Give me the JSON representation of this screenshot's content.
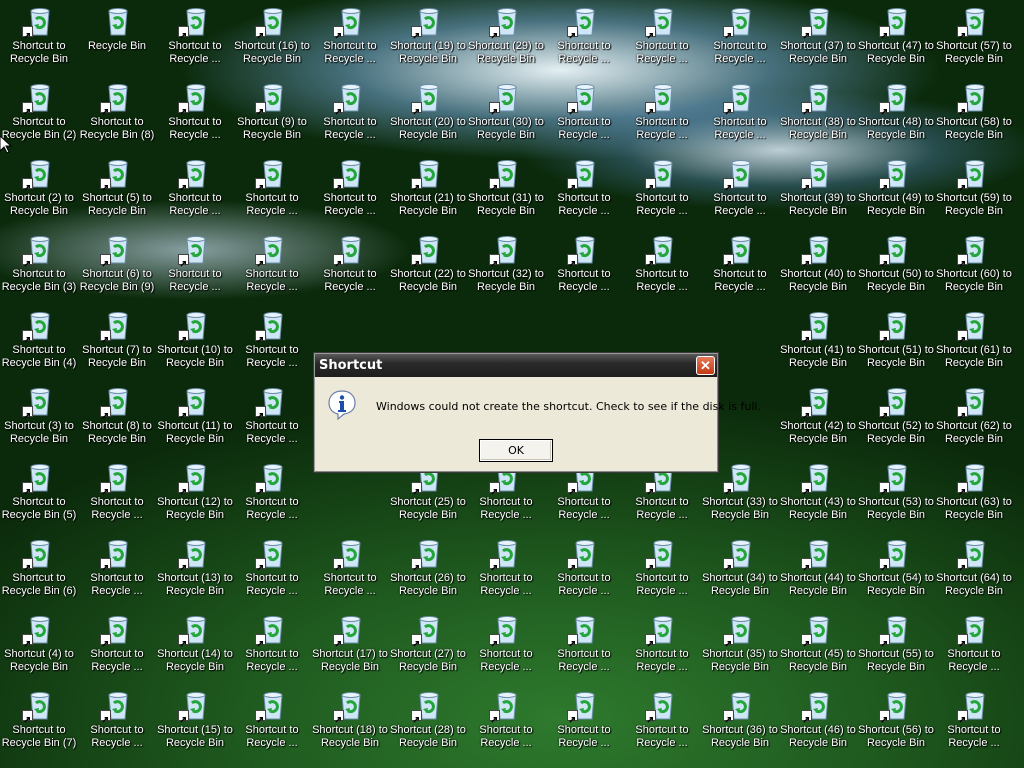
{
  "desktop": {
    "icons": [
      [
        "Shortcut to Recycle Bin",
        "Shortcut to Recycle Bin (2)",
        "Shortcut (2) to Recycle Bin",
        "Shortcut to Recycle Bin (3)",
        "Shortcut to Recycle Bin (4)",
        "Shortcut (3) to Recycle Bin",
        "Shortcut to Recycle Bin (5)",
        "Shortcut to Recycle Bin (6)",
        "Shortcut (4) to Recycle Bin",
        "Shortcut to Recycle Bin (7)"
      ],
      [
        "Recycle Bin",
        "Shortcut to Recycle Bin (8)",
        "Shortcut (5) to Recycle Bin",
        "Shortcut (6) to Recycle Bin (9)",
        "Shortcut (7) to Recycle Bin",
        "Shortcut (8) to Recycle Bin",
        "Shortcut to Recycle ...",
        "Shortcut to Recycle ...",
        "Shortcut to Recycle ...",
        "Shortcut to Recycle ..."
      ],
      [
        "Shortcut to Recycle ...",
        "Shortcut to Recycle ...",
        "Shortcut to Recycle ...",
        "Shortcut to Recycle ...",
        "Shortcut (10) to Recycle Bin",
        "Shortcut (11) to Recycle Bin",
        "Shortcut (12) to Recycle Bin",
        "Shortcut (13) to Recycle Bin",
        "Shortcut (14) to Recycle Bin",
        "Shortcut (15) to Recycle Bin"
      ],
      [
        "Shortcut (16) to Recycle Bin",
        "Shortcut (9) to Recycle Bin",
        "Shortcut to Recycle ...",
        "Shortcut to Recycle ...",
        "Shortcut to Recycle ...",
        "Shortcut to Recycle ...",
        "Shortcut to Recycle ...",
        "Shortcut to Recycle ...",
        "Shortcut to Recycle ...",
        "Shortcut to Recycle ..."
      ],
      [
        "Shortcut to Recycle ...",
        "Shortcut to Recycle ...",
        "Shortcut to Recycle ...",
        "Shortcut to Recycle ...",
        "",
        "",
        "",
        "Shortcut to Recycle ...",
        "Shortcut (17) to Recycle Bin",
        "Shortcut (18) to Recycle Bin"
      ],
      [
        "Shortcut (19) to Recycle Bin",
        "Shortcut (20) to Recycle Bin",
        "Shortcut (21) to Recycle Bin",
        "Shortcut (22) to Recycle Bin",
        "",
        "",
        "Shortcut (25) to Recycle Bin",
        "Shortcut (26) to Recycle Bin",
        "Shortcut (27) to Recycle Bin",
        "Shortcut (28) to Recycle Bin"
      ],
      [
        "Shortcut (29) to Recycle Bin",
        "Shortcut (30) to Recycle Bin",
        "Shortcut (31) to Recycle Bin",
        "Shortcut (32) to Recycle Bin",
        "",
        "",
        "Shortcut to Recycle ...",
        "Shortcut to Recycle ...",
        "Shortcut to Recycle ...",
        "Shortcut to Recycle ..."
      ],
      [
        "Shortcut to Recycle ...",
        "Shortcut to Recycle ...",
        "Shortcut to Recycle ...",
        "Shortcut to Recycle ...",
        "",
        "",
        "Shortcut to Recycle ...",
        "Shortcut to Recycle ...",
        "Shortcut to Recycle ...",
        "Shortcut to Recycle ..."
      ],
      [
        "Shortcut to Recycle ...",
        "Shortcut to Recycle ...",
        "Shortcut to Recycle ...",
        "Shortcut to Recycle ...",
        "",
        "",
        "Shortcut to Recycle ...",
        "Shortcut to Recycle ...",
        "Shortcut to Recycle ...",
        "Shortcut to Recycle ..."
      ],
      [
        "Shortcut to Recycle ...",
        "Shortcut to Recycle ...",
        "Shortcut to Recycle ...",
        "Shortcut to Recycle ...",
        "",
        "",
        "Shortcut (33) to Recycle Bin",
        "Shortcut (34) to Recycle Bin",
        "Shortcut (35) to Recycle Bin",
        "Shortcut (36) to Recycle Bin"
      ],
      [
        "Shortcut (37) to Recycle Bin",
        "Shortcut (38) to Recycle Bin",
        "Shortcut (39) to Recycle Bin",
        "Shortcut (40) to Recycle Bin",
        "Shortcut (41) to Recycle Bin",
        "Shortcut (42) to Recycle Bin",
        "Shortcut (43) to Recycle Bin",
        "Shortcut (44) to Recycle Bin",
        "Shortcut (45) to Recycle Bin",
        "Shortcut (46) to Recycle Bin"
      ],
      [
        "Shortcut (47) to Recycle Bin",
        "Shortcut (48) to Recycle Bin",
        "Shortcut (49) to Recycle Bin",
        "Shortcut (50) to Recycle Bin",
        "Shortcut (51) to Recycle Bin",
        "Shortcut (52) to Recycle Bin",
        "Shortcut (53) to Recycle Bin",
        "Shortcut (54) to Recycle Bin",
        "Shortcut (55) to Recycle Bin",
        "Shortcut (56) to Recycle Bin"
      ],
      [
        "Shortcut (57) to Recycle Bin",
        "Shortcut (58) to Recycle Bin",
        "Shortcut (59) to Recycle Bin",
        "Shortcut (60) to Recycle Bin",
        "Shortcut (61) to Recycle Bin",
        "Shortcut (62) to Recycle Bin",
        "Shortcut (63) to Recycle Bin",
        "Shortcut (64) to Recycle Bin",
        "Shortcut to Recycle ...",
        "Shortcut to Recycle ..."
      ]
    ],
    "icon_name": "recycle-bin-icon",
    "shortcut_overlay_icon": "shortcut-arrow-icon"
  },
  "dialog": {
    "title": "Shortcut",
    "close_label": "✕",
    "message": "Windows could not create the shortcut. Check to see if the disk is full.",
    "ok_label": "OK",
    "icon": "info-icon"
  },
  "colors": {
    "dialog_bg": "#ece9d8",
    "titlebar": "#2a2a2a",
    "close_button": "#c23a12",
    "label_text": "#ffffff"
  }
}
